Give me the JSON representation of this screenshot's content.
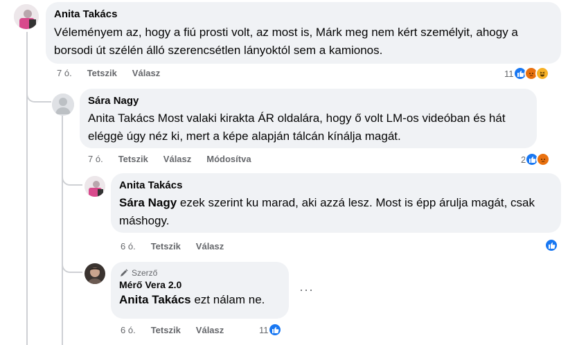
{
  "comments": [
    {
      "author": "Anita Takács",
      "text": "Véleményem az, hogy a fiú prosti volt, az most is, Márk meg nem kért személyit, ahogy a borsodi út szélén álló szerencsétlen lányoktól sem a kamionos.",
      "time": "7 ó.",
      "like": "Tetszik",
      "reply": "Válasz",
      "reaction_count": "11",
      "reactions": [
        "like",
        "angry",
        "haha"
      ]
    },
    {
      "author": "Sára Nagy",
      "text": "Anita Takács Most valaki kirakta ÁR oldalára, hogy ő volt LM-os videóban és hát eléggè úgy néz ki, mert a képe alapján tálcán kínálja magát.",
      "time": "7 ó.",
      "like": "Tetszik",
      "reply": "Válasz",
      "edited": "Módosítva",
      "reaction_count": "2",
      "reactions": [
        "like",
        "angry"
      ]
    },
    {
      "author": "Anita Takács",
      "mention": "Sára Nagy",
      "text": " ezek szerint ku marad, aki azzá lesz. Most is épp árulja magát, csak máshogy.",
      "time": "6 ó.",
      "like": "Tetszik",
      "reply": "Válasz",
      "reactions": [
        "like"
      ]
    },
    {
      "badge": "Szerző",
      "author": "Mérő Vera 2.0",
      "mention": "Anita Takács",
      "text": " ezt nálam ne.",
      "time": "6 ó.",
      "like": "Tetszik",
      "reply": "Válasz",
      "reaction_count": "11",
      "reactions": [
        "like"
      ],
      "more": "···"
    }
  ],
  "colors": {
    "bubble": "#f0f2f5",
    "like": "#1877f2",
    "angry": "#e9710f",
    "haha": "#f7b125",
    "meta": "#65676b"
  }
}
